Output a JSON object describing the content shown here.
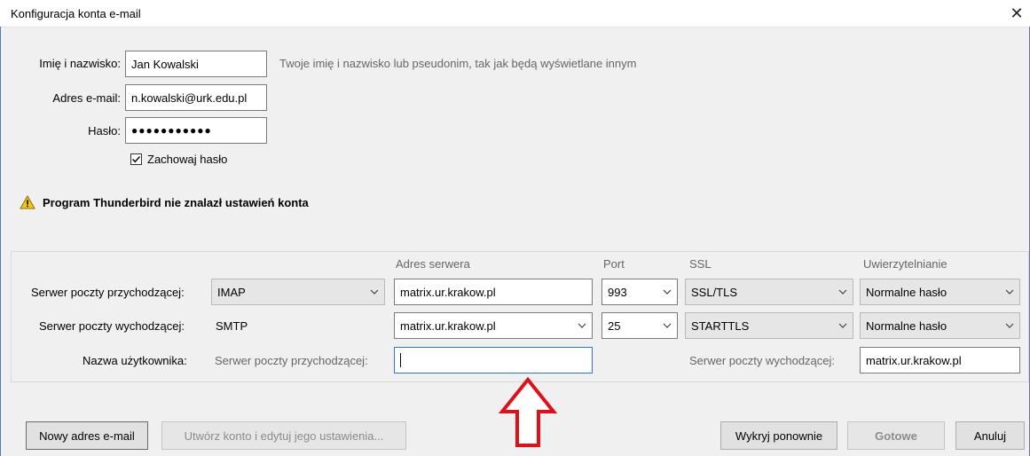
{
  "window": {
    "title": "Konfiguracja konta e-mail",
    "close_glyph": "✕"
  },
  "identity": {
    "name_label": "Imię i nazwisko:",
    "name_value": "Jan Kowalski",
    "name_hint": "Twoje imię i nazwisko lub pseudonim, tak jak będą wyświetlane innym",
    "email_label": "Adres e-mail:",
    "email_value": "n.kowalski@urk.edu.pl",
    "password_label": "Hasło:",
    "password_value": "●●●●●●●●●●●",
    "remember_label": "Zachowaj hasło",
    "remember_checked": true
  },
  "warning": {
    "icon": "warning-icon",
    "text": "Program Thunderbird nie znalazł ustawień konta",
    "color": "#f5c518"
  },
  "server": {
    "headers": {
      "address": "Adres serwera",
      "port": "Port",
      "ssl": "SSL",
      "auth": "Uwierzytelnianie"
    },
    "incoming": {
      "label": "Serwer poczty przychodzącej:",
      "protocol": "IMAP",
      "address": "matrix.ur.krakow.pl",
      "port": "993",
      "ssl": "SSL/TLS",
      "auth": "Normalne hasło"
    },
    "outgoing": {
      "label": "Serwer poczty wychodzącej:",
      "protocol": "SMTP",
      "address": "matrix.ur.krakow.pl",
      "port": "25",
      "ssl": "STARTTLS",
      "auth": "Normalne hasło"
    },
    "username": {
      "label": "Nazwa użytkownika:",
      "incoming_label": "Serwer poczty przychodzącej:",
      "incoming_value": "",
      "outgoing_label": "Serwer poczty wychodzącej:",
      "outgoing_value": "matrix.ur.krakow.pl"
    }
  },
  "buttons": {
    "new_email": "Nowy adres e-mail",
    "create_edit": "Utwórz konto i edytuj jego ustawienia...",
    "redetect": "Wykryj ponownie",
    "done": "Gotowe",
    "cancel": "Anuluj"
  },
  "annotation": {
    "arrow_color": "#e0101a",
    "arrow_icon": "up-arrow-icon"
  }
}
